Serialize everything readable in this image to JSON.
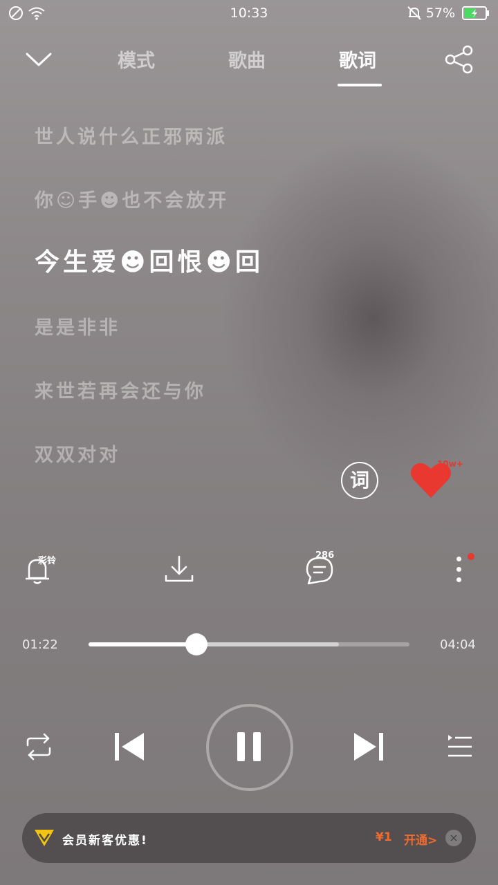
{
  "status_bar": {
    "time": "10:33",
    "battery_percent": "57%",
    "battery_level": 0.57
  },
  "nav": {
    "tabs": [
      {
        "label": "模式"
      },
      {
        "label": "歌曲"
      },
      {
        "label": "歌词",
        "active": true
      }
    ]
  },
  "lyrics": {
    "lines": [
      "世人说什么正邪两派",
      "你☺手☻也不会放开",
      "今生爱☻回恨☻回",
      "是是非非",
      "来世若再会还与你",
      "双双对对"
    ],
    "current_index": 2
  },
  "actions": {
    "lyric_button": "词",
    "favorite_count": "10w+",
    "ringtone_label": "彩铃",
    "comment_count": "286"
  },
  "progress": {
    "elapsed": "01:22",
    "total": "04:04",
    "played_fraction": 0.336,
    "buffered_fraction": 0.78
  },
  "vip_banner": {
    "text": "会员新客优惠!",
    "price": "¥1",
    "cta": "开通>",
    "close": "×"
  },
  "colors": {
    "accent": "#e8382f",
    "vip_orange": "#f26a2e",
    "battery_green": "#4cd964"
  },
  "icons": [
    "no-sim-icon",
    "wifi-icon",
    "mute-bell-icon",
    "battery-icon",
    "collapse-chevron-icon",
    "share-icon",
    "heart-icon",
    "ringtone-bell-icon",
    "download-icon",
    "comment-icon",
    "more-icon",
    "repeat-icon",
    "previous-icon",
    "pause-icon",
    "next-icon",
    "playlist-icon",
    "vip-diamond-icon"
  ]
}
